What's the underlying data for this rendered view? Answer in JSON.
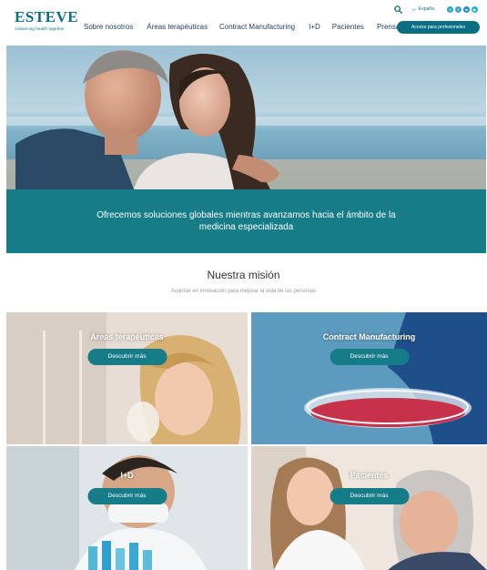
{
  "header": {
    "logo_text": "ESTEVE",
    "logo_tagline": "Advancing health together",
    "nav": [
      "Sobre nosotros",
      "Áreas terapéuticas",
      "Contract Manufacturing",
      "I+D",
      "Pacientes",
      "Prensa"
    ],
    "language": "España",
    "pro_access_label": "Acceso para profesionales",
    "social_icons": [
      "twitter-icon",
      "facebook-icon",
      "linkedin-icon",
      "youtube-icon"
    ]
  },
  "hero": {
    "tagline": "Ofrecemos soluciones globales mientras avanzamos hacia el ámbito de la medicina especializada"
  },
  "mission": {
    "title": "Nuestra misión",
    "subtitle": "Avanzar en innovación para mejorar la vida de las personas"
  },
  "tiles": [
    {
      "title": "Áreas terapéuticas",
      "button": "Descubrir más"
    },
    {
      "title": "Contract Manufacturing",
      "button": "Descubrir más"
    },
    {
      "title": "I+D",
      "button": "Descubrir más"
    },
    {
      "title": "Pacientes",
      "button": "Descubrir más"
    }
  ],
  "colors": {
    "brand_teal": "#157c88",
    "brand_dark_teal": "#0b6f82",
    "nav_text": "#1d3c5a"
  }
}
